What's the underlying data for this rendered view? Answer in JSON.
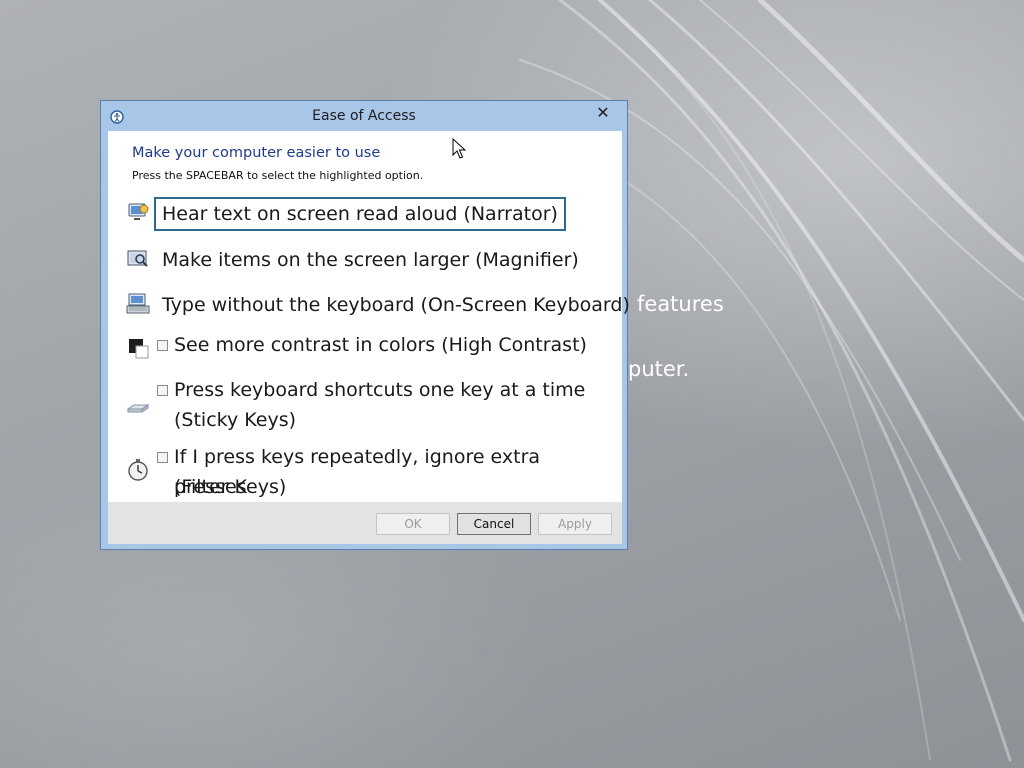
{
  "desktop": {
    "bg_line_1": "features",
    "bg_line_2": "puter."
  },
  "dialog": {
    "title": "Ease of Access",
    "close_glyph": "✕",
    "heading": "Make your computer easier to use",
    "hint": "Press the SPACEBAR to select the highlighted option.",
    "options": [
      {
        "label": "Hear text on screen read aloud (Narrator)",
        "icon": "narrator-icon",
        "focused": true
      },
      {
        "label": "Make items on the screen larger (Magnifier)",
        "icon": "magnifier-icon"
      },
      {
        "label": "Type without the keyboard (On-Screen Keyboard)",
        "icon": "keyboard-icon"
      }
    ],
    "checkbox_options": [
      {
        "lines": [
          "See more contrast in colors (High Contrast)"
        ],
        "icon": "high-contrast-icon",
        "checked": false
      },
      {
        "lines": [
          "Press keyboard shortcuts one key at a time",
          "(Sticky Keys)"
        ],
        "icon": "sticky-keys-icon",
        "checked": false
      },
      {
        "lines": [
          "If I press keys repeatedly, ignore extra presses",
          "(Filter Keys)"
        ],
        "icon": "filter-keys-icon",
        "checked": false
      }
    ],
    "buttons": {
      "ok": "OK",
      "cancel": "Cancel",
      "apply": "Apply"
    }
  },
  "colors": {
    "frame": "#a8c6e8",
    "heading": "#1f3b8a",
    "focus_border": "#2d6a8f"
  }
}
